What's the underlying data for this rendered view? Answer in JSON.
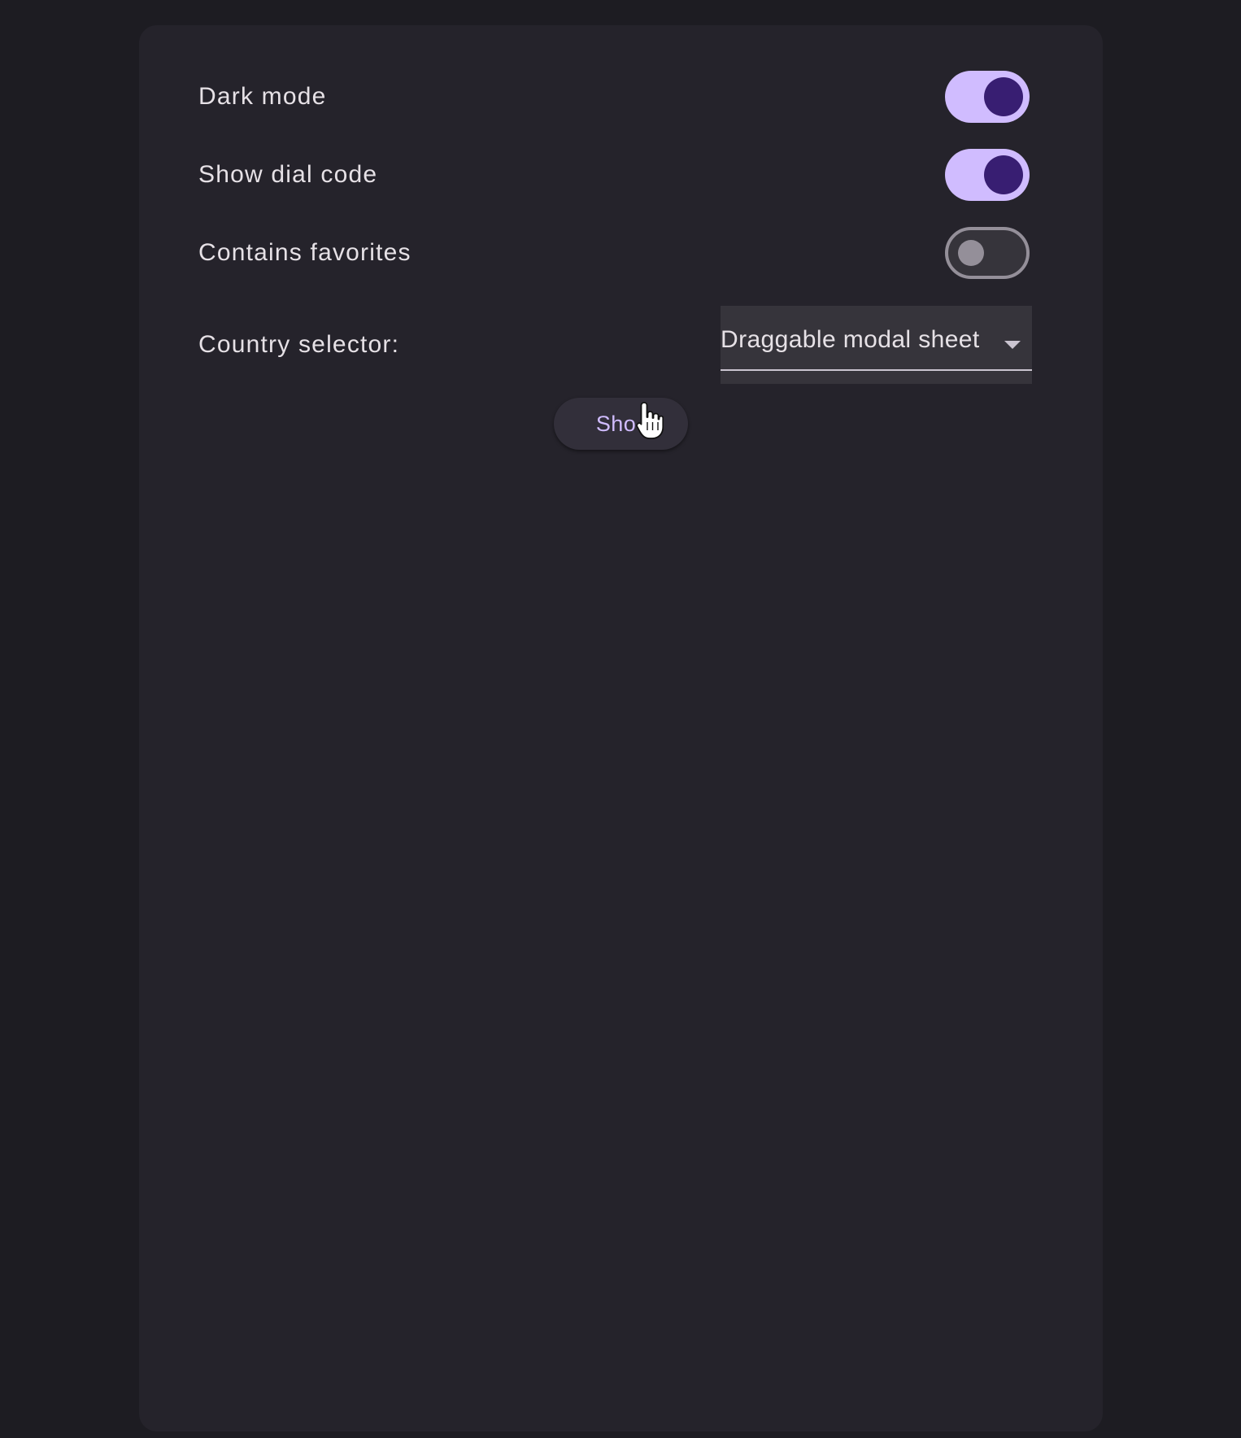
{
  "settings": {
    "dark_mode": {
      "label": "Dark mode",
      "enabled": true
    },
    "show_dial_code": {
      "label": "Show dial code",
      "enabled": true
    },
    "contains_favorites": {
      "label": "Contains favorites",
      "enabled": false
    }
  },
  "country_selector": {
    "label": "Country selector:",
    "selected": "Draggable modal sheet"
  },
  "show_button": {
    "label": "Sho"
  },
  "icons": {
    "dropdown_arrow": "arrow-drop-down-icon",
    "cursor": "hand-pointer-icon"
  },
  "colors": {
    "background": "#1d1c22",
    "card": "#25232b",
    "accent": "#d0bcff",
    "accent_dark": "#381e72",
    "switch_off_outline": "#948f99"
  }
}
